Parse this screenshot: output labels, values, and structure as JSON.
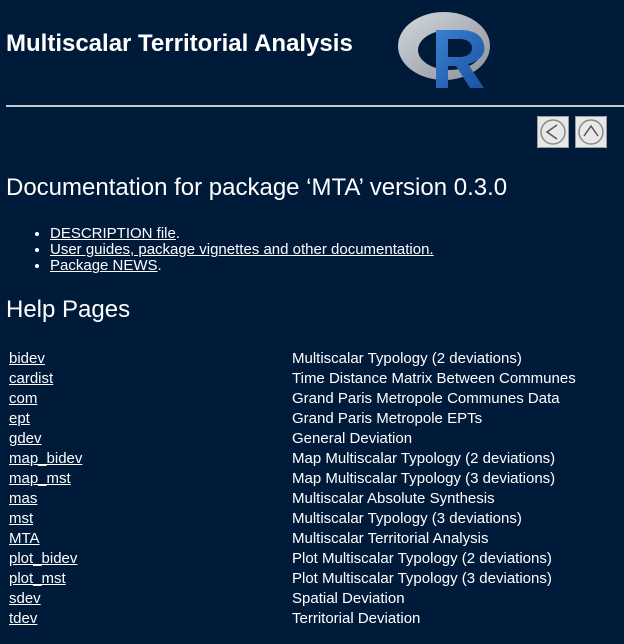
{
  "header": {
    "title": "Multiscalar Territorial Analysis",
    "logo_letter": "R",
    "logo_icon": "r-logo-icon"
  },
  "nav": {
    "left_icon": "arrow-left-icon",
    "up_icon": "arrow-up-icon"
  },
  "documentation": {
    "title": "Documentation for package ‘MTA’ version 0.3.0",
    "links": [
      {
        "link_text": "DESCRIPTION file",
        "suffix": "."
      },
      {
        "link_text": "User guides, package vignettes and other documentation.",
        "suffix": ""
      },
      {
        "link_text": "Package NEWS",
        "suffix": "."
      }
    ]
  },
  "help": {
    "heading": "Help Pages",
    "rows": [
      {
        "topic": "bidev",
        "description": "Multiscalar Typology (2 deviations)"
      },
      {
        "topic": "cardist",
        "description": "Time Distance Matrix Between Communes"
      },
      {
        "topic": "com",
        "description": "Grand Paris Metropole Communes Data"
      },
      {
        "topic": "ept",
        "description": "Grand Paris Metropole EPTs"
      },
      {
        "topic": "gdev",
        "description": "General Deviation"
      },
      {
        "topic": "map_bidev",
        "description": "Map Multiscalar Typology (2 deviations)"
      },
      {
        "topic": "map_mst",
        "description": "Map Multiscalar Typology (3 deviations)"
      },
      {
        "topic": "mas",
        "description": "Multiscalar Absolute Synthesis"
      },
      {
        "topic": "mst",
        "description": "Multiscalar Typology (3 deviations)"
      },
      {
        "topic": "MTA",
        "description": "Multiscalar Territorial Analysis"
      },
      {
        "topic": "plot_bidev",
        "description": "Plot Multiscalar Typology (2 deviations)"
      },
      {
        "topic": "plot_mst",
        "description": "Plot Multiscalar Typology (3 deviations)"
      },
      {
        "topic": "sdev",
        "description": "Spatial Deviation"
      },
      {
        "topic": "tdev",
        "description": "Territorial Deviation"
      }
    ]
  },
  "colors": {
    "background": "#001a3a",
    "text": "#ffffff",
    "logo_ring": "#b7bcc4",
    "logo_letter": "#2266b8"
  }
}
